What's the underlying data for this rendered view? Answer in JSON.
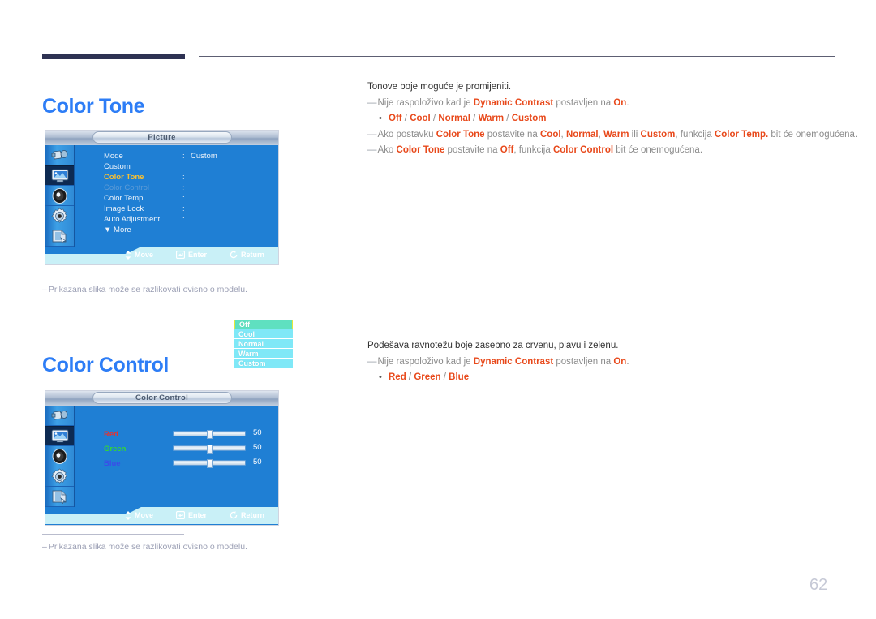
{
  "page": {
    "number": "62"
  },
  "sections": [
    {
      "title": "Color Tone",
      "intro": "Tonove boje moguće je promijeniti.",
      "notes": [
        [
          {
            "t": "Nije raspoloživo kad je ",
            "s": "gy"
          },
          {
            "t": "Dynamic Contrast",
            "s": "or"
          },
          {
            "t": " postavljen na ",
            "s": "gy"
          },
          {
            "t": "On",
            "s": "or"
          },
          {
            "t": ".",
            "s": "gy"
          }
        ],
        [
          {
            "t": "Ako postavku ",
            "s": "gy"
          },
          {
            "t": "Color Tone",
            "s": "or"
          },
          {
            "t": " postavite na ",
            "s": "gy"
          },
          {
            "t": "Cool",
            "s": "or"
          },
          {
            "t": ", ",
            "s": "gy"
          },
          {
            "t": "Normal",
            "s": "or"
          },
          {
            "t": ", ",
            "s": "gy"
          },
          {
            "t": "Warm",
            "s": "or"
          },
          {
            "t": " ili ",
            "s": "gy"
          },
          {
            "t": "Custom",
            "s": "or"
          },
          {
            "t": ", funkcija ",
            "s": "gy"
          },
          {
            "t": "Color Temp.",
            "s": "or"
          },
          {
            "t": " bit će onemogućena.",
            "s": "gy"
          }
        ],
        [
          {
            "t": "Ako ",
            "s": "gy"
          },
          {
            "t": "Color Tone",
            "s": "or"
          },
          {
            "t": " postavite na ",
            "s": "gy"
          },
          {
            "t": "Off",
            "s": "or"
          },
          {
            "t": ", funkcija ",
            "s": "gy"
          },
          {
            "t": "Color Control",
            "s": "or"
          },
          {
            "t": " bit će onemogućena.",
            "s": "gy"
          }
        ]
      ],
      "bullet": [
        {
          "t": "Off",
          "s": "or"
        },
        {
          "t": " / ",
          "s": "sep"
        },
        {
          "t": "Cool",
          "s": "or"
        },
        {
          "t": " / ",
          "s": "sep"
        },
        {
          "t": "Normal",
          "s": "or"
        },
        {
          "t": " / ",
          "s": "sep"
        },
        {
          "t": "Warm",
          "s": "or"
        },
        {
          "t": " / ",
          "s": "sep"
        },
        {
          "t": "Custom",
          "s": "or"
        }
      ],
      "bullet_after_note": 0,
      "footnote": "Prikazana slika može se razlikovati ovisno o modelu."
    },
    {
      "title": "Color Control",
      "intro": "Podešava ravnotežu boje zasebno za crvenu, plavu i zelenu.",
      "notes": [
        [
          {
            "t": "Nije raspoloživo kad je ",
            "s": "gy"
          },
          {
            "t": "Dynamic Contrast",
            "s": "or"
          },
          {
            "t": " postavljen na ",
            "s": "gy"
          },
          {
            "t": "On",
            "s": "or"
          },
          {
            "t": ".",
            "s": "gy"
          }
        ]
      ],
      "bullet": [
        {
          "t": "Red",
          "s": "or"
        },
        {
          "t": " / ",
          "s": "sep"
        },
        {
          "t": "Green",
          "s": "or"
        },
        {
          "t": " / ",
          "s": "sep"
        },
        {
          "t": "Blue",
          "s": "or"
        }
      ],
      "footnote": "Prikazana slika može se razlikovati ovisno o modelu."
    }
  ],
  "osd_picture": {
    "title": "Picture",
    "rail_icons": [
      "input-source-icon",
      "picture-icon",
      "sound-icon",
      "setup-gear-icon",
      "multi-control-icon"
    ],
    "rail_active_index": 1,
    "menu": [
      {
        "label": "Mode",
        "colon": ":",
        "value": "Custom",
        "state": "normal"
      },
      {
        "label": "Custom",
        "colon": "",
        "value": "",
        "state": "normal"
      },
      {
        "label": "Color Tone",
        "colon": ":",
        "value": "",
        "state": "selected"
      },
      {
        "label": "Color Control",
        "colon": ":",
        "value": "",
        "state": "disabled"
      },
      {
        "label": "Color Temp.",
        "colon": ":",
        "value": "",
        "state": "normal"
      },
      {
        "label": "Image Lock",
        "colon": ":",
        "value": "",
        "state": "normal"
      },
      {
        "label": "Auto Adjustment",
        "colon": ":",
        "value": "",
        "state": "normal"
      }
    ],
    "more_label": "▼ More",
    "dropdown": {
      "items": [
        "Off",
        "Cool",
        "Normal",
        "Warm",
        "Custom"
      ],
      "highlighted_index": 0
    },
    "footer": [
      {
        "icon": "up-down-arrow-icon",
        "label": "Move"
      },
      {
        "icon": "enter-key-icon",
        "label": "Enter"
      },
      {
        "icon": "return-arrow-icon",
        "label": "Return"
      }
    ]
  },
  "osd_colorcontrol": {
    "title": "Color Control",
    "rail_icons": [
      "input-source-icon",
      "picture-icon",
      "sound-icon",
      "setup-gear-icon",
      "multi-control-icon"
    ],
    "rail_active_index": 1,
    "sliders": [
      {
        "label": "Red",
        "value": "50",
        "pct": 47,
        "color": "r"
      },
      {
        "label": "Green",
        "value": "50",
        "pct": 47,
        "color": "g"
      },
      {
        "label": "Blue",
        "value": "50",
        "pct": 47,
        "color": "b"
      }
    ],
    "footer": [
      {
        "icon": "up-down-arrow-icon",
        "label": "Move"
      },
      {
        "icon": "enter-key-icon",
        "label": "Enter"
      },
      {
        "icon": "return-arrow-icon",
        "label": "Return"
      }
    ]
  },
  "colors": {
    "heading": "#2d7df6",
    "accent_orange": "#e8491b",
    "osd_blue": "#1f7fd4",
    "osd_footer": "#c9f0f7",
    "rule_dark": "#2e3253"
  }
}
